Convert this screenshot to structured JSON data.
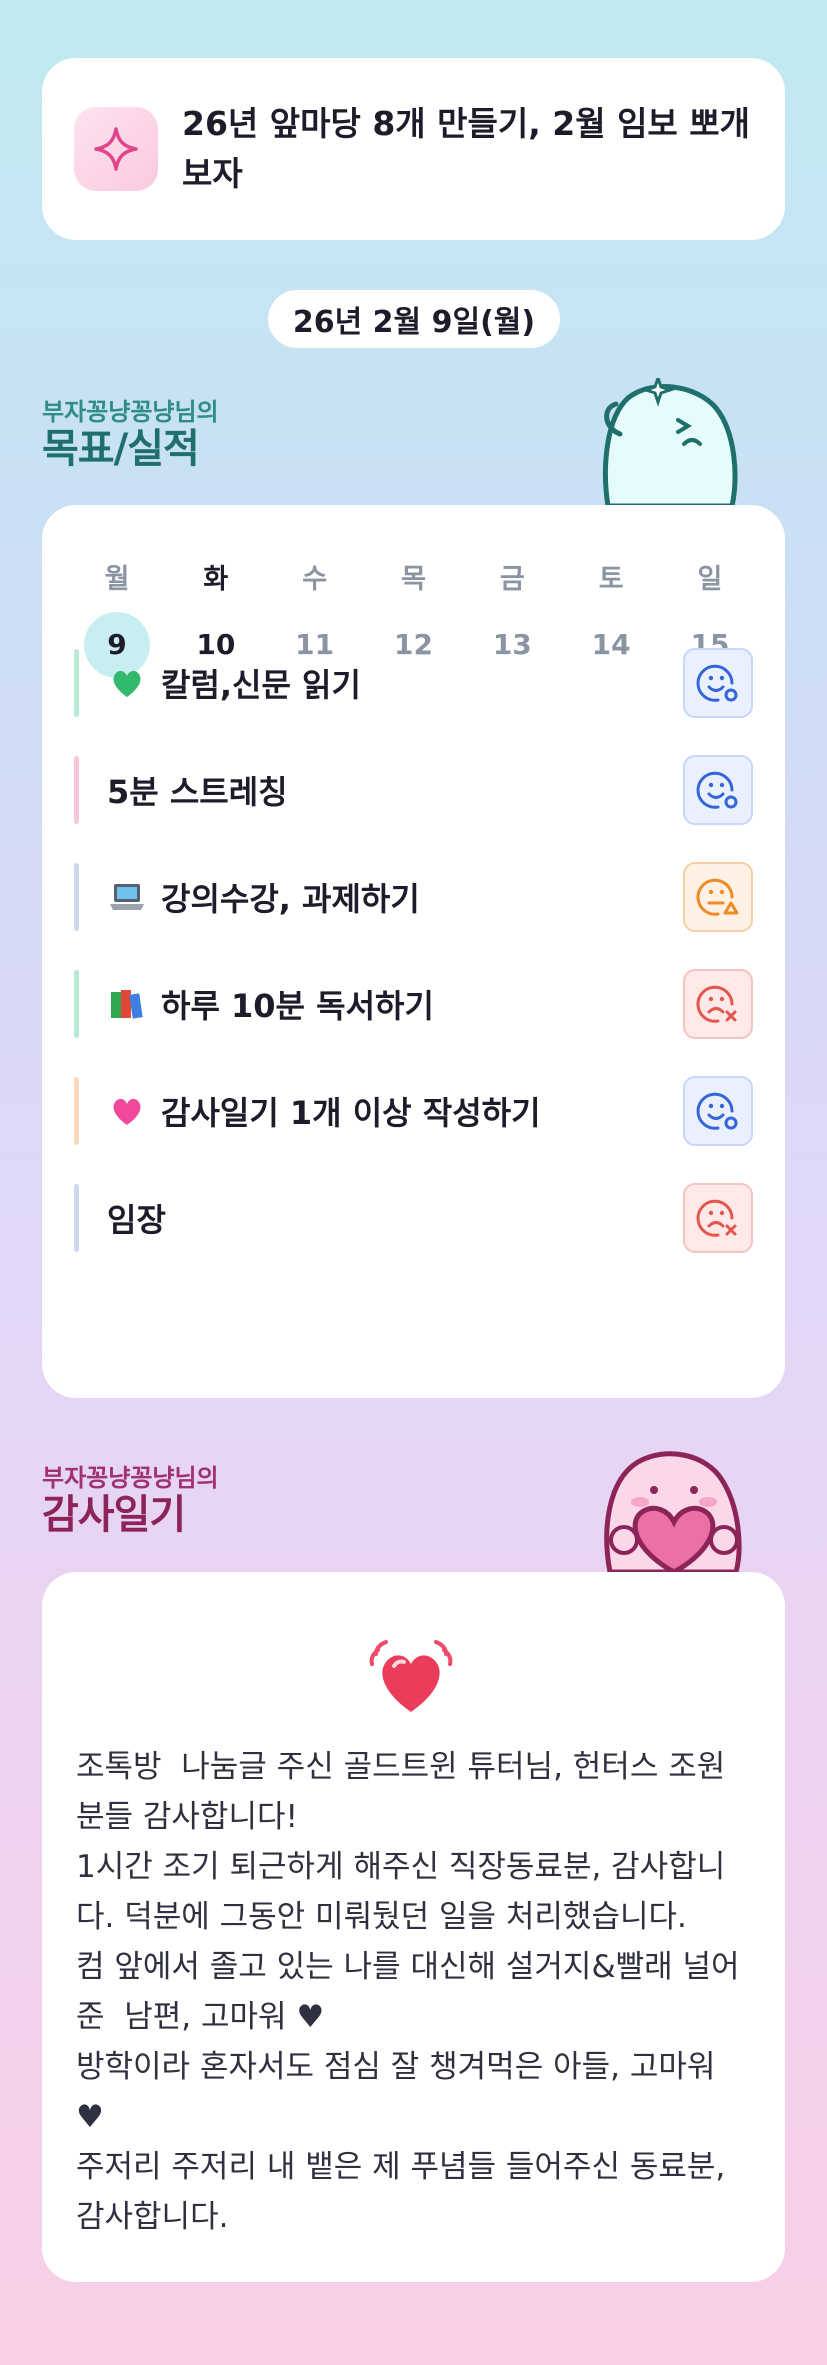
{
  "goal": {
    "text": "26년 앞마당 8개 만들기, 2월 임보 뽀개보자",
    "icon": "sparkle-icon"
  },
  "date_label": "26년 2월 9일(월)",
  "goals_section": {
    "subtitle": "부자꽁냥꽁냥님의",
    "title": "목표/실적",
    "subtitle_color": "#2f8c88",
    "title_color": "#1f6f6b"
  },
  "week": {
    "days": [
      {
        "wd": "월",
        "num": "9"
      },
      {
        "wd": "화",
        "num": "10"
      },
      {
        "wd": "수",
        "num": "11"
      },
      {
        "wd": "목",
        "num": "12"
      },
      {
        "wd": "금",
        "num": "13"
      },
      {
        "wd": "토",
        "num": "14"
      },
      {
        "wd": "일",
        "num": "15"
      }
    ],
    "selected_index": 0,
    "today_index": 1
  },
  "tasks": [
    {
      "emoji": "green-heart-icon",
      "label": "칼럼,신문 읽기",
      "bar": "#b9ead6",
      "status": "done"
    },
    {
      "emoji": "",
      "label": "5분 스트레칭",
      "bar": "#f7c6dc",
      "status": "done"
    },
    {
      "emoji": "laptop-icon",
      "label": "강의수강, 과제하기",
      "bar": "#cfd6f2",
      "status": "partial"
    },
    {
      "emoji": "books-icon",
      "label": "하루 10분 독서하기",
      "bar": "#b9ead6",
      "status": "failed"
    },
    {
      "emoji": "pink-heart-icon",
      "label": "감사일기 1개 이상 작성하기",
      "bar": "#fbd9bd",
      "status": "done"
    },
    {
      "emoji": "",
      "label": "임장",
      "bar": "#cfd6f2",
      "status": "failed"
    }
  ],
  "status_colors": {
    "done": "#3566d8",
    "partial": "#f08a24",
    "failed": "#e5564f"
  },
  "gratitude_section": {
    "subtitle": "부자꽁냥꽁냥님의",
    "title": "감사일기",
    "subtitle_color": "#a0336e",
    "title_color": "#8c2458"
  },
  "gratitude": {
    "icon": "heart-beat-icon",
    "text": "조톡방  나눔글 주신 골드트윈 튜터님, 헌터스 조원분들 감사합니다!\n1시간 조기 퇴근하게 해주신 직장동료분, 감사합니다. 덕분에 그동안 미뤄뒀던 일을 처리했습니다.\n컴 앞에서 졸고 있는 나를 대신해 설거지&빨래 널어준  남편, 고마워 ♥\n방학이라 혼자서도 점심 잘 챙겨먹은 아들, 고마워 ♥\n주저리 주저리 내 뱉은 제 푸념들 들어주신 동료분, 감사합니다."
  }
}
